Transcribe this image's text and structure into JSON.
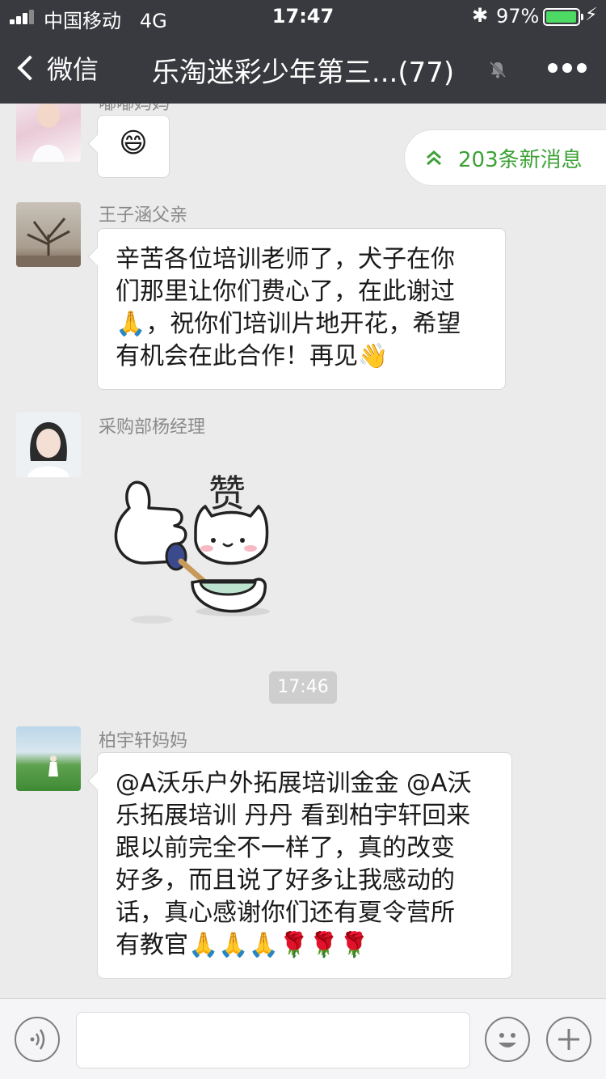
{
  "status_bar": {
    "carrier": "中国移动",
    "network": "4G",
    "time": "17:47",
    "battery_percent": "97%",
    "battery_level": 0.97
  },
  "nav": {
    "back_label": "微信",
    "title": "乐淘迷彩少年第三...(77)"
  },
  "new_messages_label": "203条新消息",
  "messages": [
    {
      "sender": "嘟嘟妈妈",
      "text": "😄"
    },
    {
      "sender": "王子涵父亲",
      "lines": [
        "辛苦各位培训老师了，犬子在你",
        "们那里让你们费心了，在此谢过",
        "🙏，祝你们培训片地开花，希望",
        "有机会在此合作！再见👋"
      ]
    },
    {
      "sender": "采购部杨经理",
      "sticker_text": "赞"
    },
    {
      "sender": "柏宇轩妈妈",
      "lines": [
        "@A沃乐户外拓展培训金金 @A沃",
        "乐拓展培训 丹丹 看到柏宇轩回来",
        "跟以前完全不一样了，真的改变",
        "好多，而且说了好多让我感动的",
        "话，真心感谢你们还有夏令营所",
        "有教官🙏🙏🙏🌹🌹🌹"
      ]
    }
  ],
  "timestamp": "17:46",
  "input": {
    "value": "",
    "placeholder": ""
  },
  "colors": {
    "nav_bg": "#393a3f",
    "chat_bg": "#ebebeb",
    "accent_green": "#3ca135",
    "battery_green": "#4cd964"
  }
}
